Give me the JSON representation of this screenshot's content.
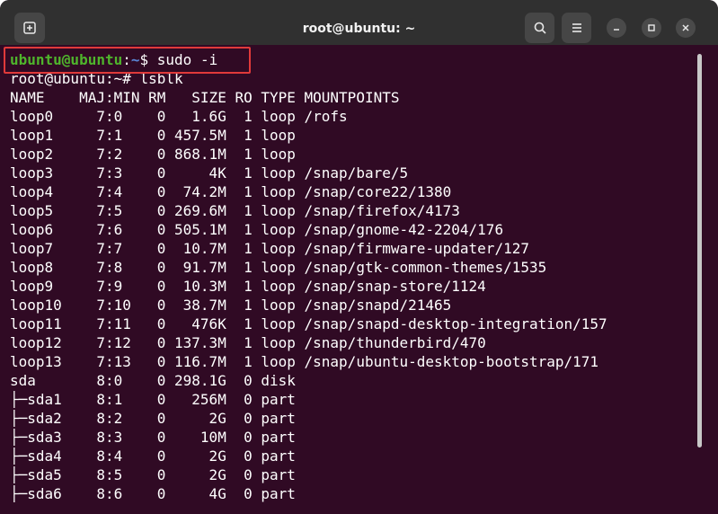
{
  "window": {
    "title": "root@ubuntu: ~"
  },
  "icons": {
    "new_tab": "new-tab-icon",
    "search": "search-icon",
    "menu": "hamburger-menu-icon",
    "minimize": "minimize-icon",
    "maximize": "maximize-icon",
    "close": "close-icon"
  },
  "colors": {
    "background": "#300a24",
    "titlebar": "#303030",
    "prompt_user": "#4fb52c",
    "prompt_path": "#5a86d6",
    "highlight": "#e03a3a"
  },
  "terminal": {
    "prompt1": {
      "user_host": "ubuntu@ubuntu",
      "colon": ":",
      "path": "~",
      "symbol": "$ ",
      "command": "sudo -i"
    },
    "prompt2": "root@ubuntu:~# lsblk",
    "output": [
      "NAME    MAJ:MIN RM   SIZE RO TYPE MOUNTPOINTS",
      "loop0     7:0    0   1.6G  1 loop /rofs",
      "loop1     7:1    0 457.5M  1 loop",
      "loop2     7:2    0 868.1M  1 loop",
      "loop3     7:3    0     4K  1 loop /snap/bare/5",
      "loop4     7:4    0  74.2M  1 loop /snap/core22/1380",
      "loop5     7:5    0 269.6M  1 loop /snap/firefox/4173",
      "loop6     7:6    0 505.1M  1 loop /snap/gnome-42-2204/176",
      "loop7     7:7    0  10.7M  1 loop /snap/firmware-updater/127",
      "loop8     7:8    0  91.7M  1 loop /snap/gtk-common-themes/1535",
      "loop9     7:9    0  10.3M  1 loop /snap/snap-store/1124",
      "loop10    7:10   0  38.7M  1 loop /snap/snapd/21465",
      "loop11    7:11   0   476K  1 loop /snap/snapd-desktop-integration/157",
      "loop12    7:12   0 137.3M  1 loop /snap/thunderbird/470",
      "loop13    7:13   0 116.7M  1 loop /snap/ubuntu-desktop-bootstrap/171",
      "sda       8:0    0 298.1G  0 disk",
      "├─sda1    8:1    0   256M  0 part",
      "├─sda2    8:2    0     2G  0 part",
      "├─sda3    8:3    0    10M  0 part",
      "├─sda4    8:4    0     2G  0 part",
      "├─sda5    8:5    0     2G  0 part",
      "├─sda6    8:6    0     4G  0 part"
    ]
  }
}
